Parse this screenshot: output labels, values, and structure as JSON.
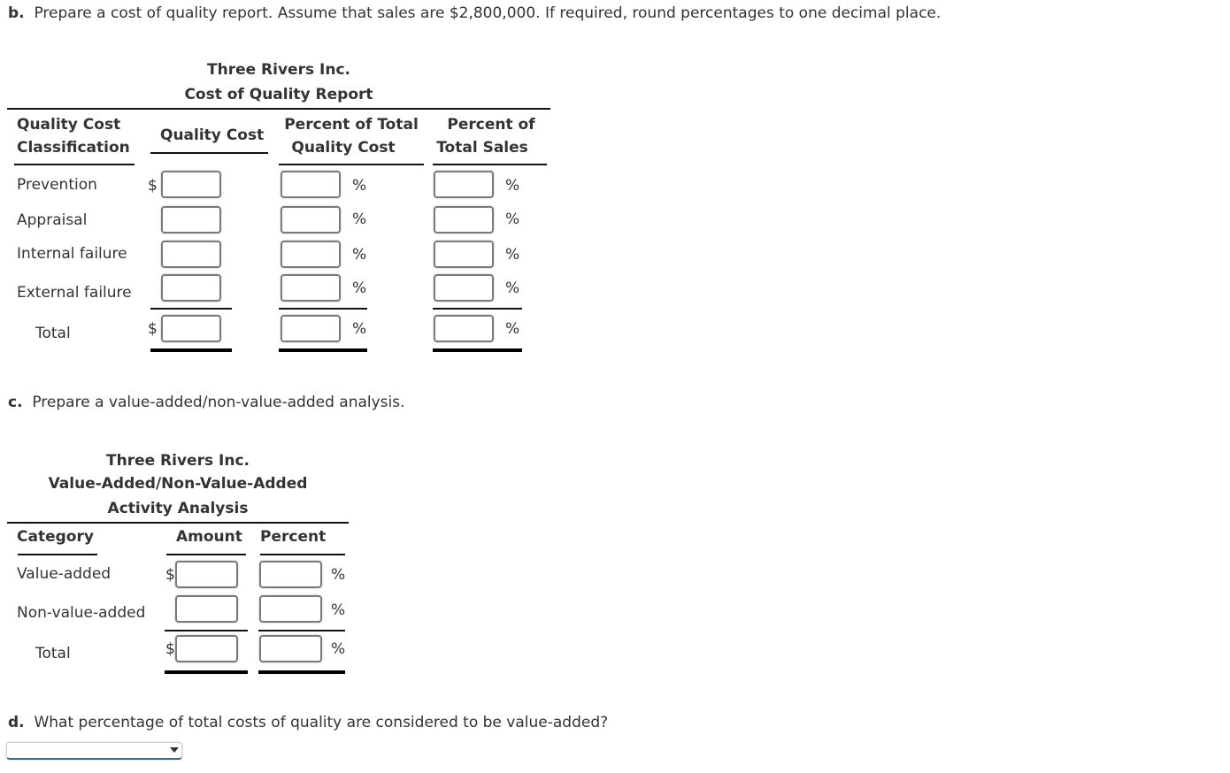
{
  "part_b": {
    "letter": "b.",
    "instruction": "Prepare a cost of quality report. Assume that sales are $2,800,000. If required, round percentages to one decimal place.",
    "report": {
      "company": "Three Rivers Inc.",
      "title": "Cost of Quality Report",
      "headers": {
        "classification_line1": "Quality Cost",
        "classification_line2": "Classification",
        "quality_cost": "Quality Cost",
        "pct_total_qc_line1": "Percent of Total",
        "pct_total_qc_line2": "Quality Cost",
        "pct_sales_line1": "Percent of",
        "pct_sales_line2": "Total Sales"
      },
      "rows": [
        {
          "label": "Prevention",
          "quality_cost": "",
          "pct_total_quality_cost": "",
          "pct_total_sales": "",
          "currency": "$"
        },
        {
          "label": "Appraisal",
          "quality_cost": "",
          "pct_total_quality_cost": "",
          "pct_total_sales": "",
          "currency": ""
        },
        {
          "label": "Internal failure",
          "quality_cost": "",
          "pct_total_quality_cost": "",
          "pct_total_sales": "",
          "currency": ""
        },
        {
          "label": "External failure",
          "quality_cost": "",
          "pct_total_quality_cost": "",
          "pct_total_sales": "",
          "currency": ""
        },
        {
          "label": "Total",
          "quality_cost": "",
          "pct_total_quality_cost": "",
          "pct_total_sales": "",
          "currency": "$"
        }
      ],
      "percent_symbol": "%"
    }
  },
  "part_c": {
    "letter": "c.",
    "instruction": "Prepare a value-added/non-value-added analysis.",
    "report": {
      "company": "Three Rivers Inc.",
      "title_line1": "Value-Added/Non-Value-Added",
      "title_line2": "Activity Analysis",
      "headers": {
        "category": "Category",
        "amount": "Amount",
        "percent": "Percent"
      },
      "rows": [
        {
          "label": "Value-added",
          "amount": "",
          "percent": "",
          "currency": "$"
        },
        {
          "label": "Non-value-added",
          "amount": "",
          "percent": "",
          "currency": ""
        },
        {
          "label": "Total",
          "amount": "",
          "percent": "",
          "currency": "$"
        }
      ],
      "percent_symbol": "%"
    }
  },
  "part_d": {
    "letter": "d.",
    "question": "What percentage of total costs of quality are considered to be value-added?",
    "dropdown_selected": ""
  }
}
